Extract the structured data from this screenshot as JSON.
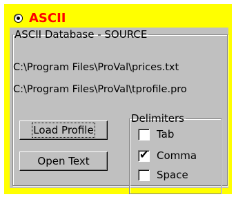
{
  "ascii_option": {
    "label": "ASCII",
    "selected": true
  },
  "source_group": {
    "title": "ASCII Database - SOURCE",
    "price_file": "C:\\Program Files\\ProVal\\prices.txt",
    "profile_file": "C:\\Program Files\\ProVal\\tprofile.pro"
  },
  "buttons": {
    "load_profile": "Load Profile",
    "open_text": "Open Text"
  },
  "delimiters": {
    "title": "Delimiters",
    "tab": {
      "label": "Tab",
      "checked": false
    },
    "comma": {
      "label": "Comma",
      "checked": true
    },
    "space": {
      "label": "Space",
      "checked": false
    }
  },
  "colors": {
    "panel": "#ffff00",
    "accent_text": "#ff0000",
    "face": "#c0c0c0"
  }
}
